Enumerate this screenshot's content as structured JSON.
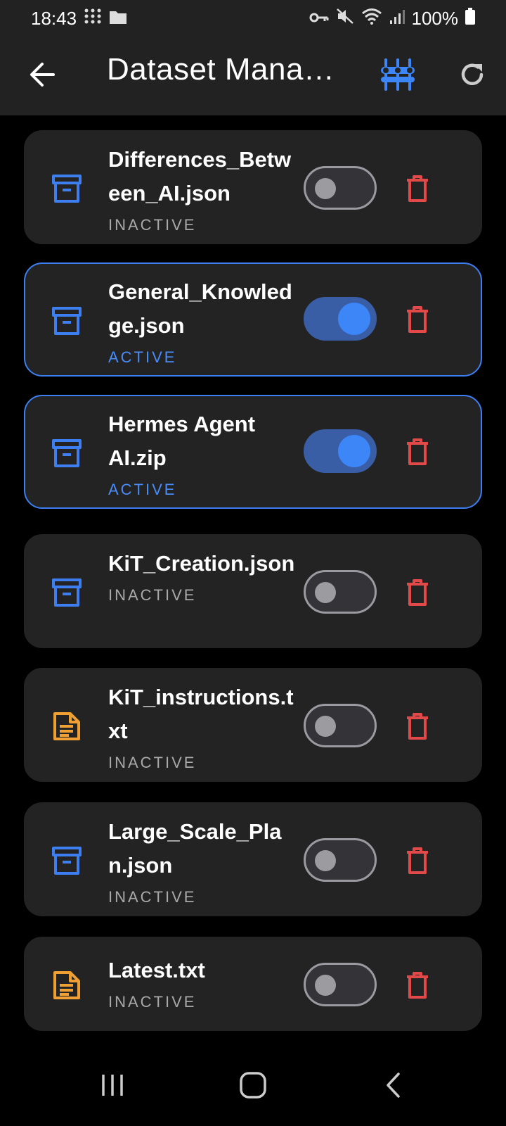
{
  "status_bar": {
    "time": "18:43",
    "battery": "100%"
  },
  "app_bar": {
    "title": "Dataset Mana…"
  },
  "colors": {
    "accent": "#3d7ef0",
    "delete": "#e24a4a",
    "archive_icon": "#3d7ef0",
    "text_icon": "#f0a032"
  },
  "datasets": [
    {
      "name": "Differences_Between_AI.json",
      "status": "INACTIVE",
      "active": false,
      "icon": "archive-icon"
    },
    {
      "name": "General_Knowledge.json",
      "status": "ACTIVE",
      "active": true,
      "icon": "archive-icon"
    },
    {
      "name": "Hermes Agent AI.zip",
      "status": "ACTIVE",
      "active": true,
      "icon": "archive-icon"
    },
    {
      "name": "KiT_Creation.json",
      "status": "INACTIVE",
      "active": false,
      "icon": "archive-icon"
    },
    {
      "name": "KiT_instructions.txt",
      "status": "INACTIVE",
      "active": false,
      "icon": "document-icon"
    },
    {
      "name": "Large_Scale_Plan.json",
      "status": "INACTIVE",
      "active": false,
      "icon": "archive-icon"
    },
    {
      "name": "Latest.txt",
      "status": "INACTIVE",
      "active": false,
      "icon": "document-icon"
    }
  ]
}
